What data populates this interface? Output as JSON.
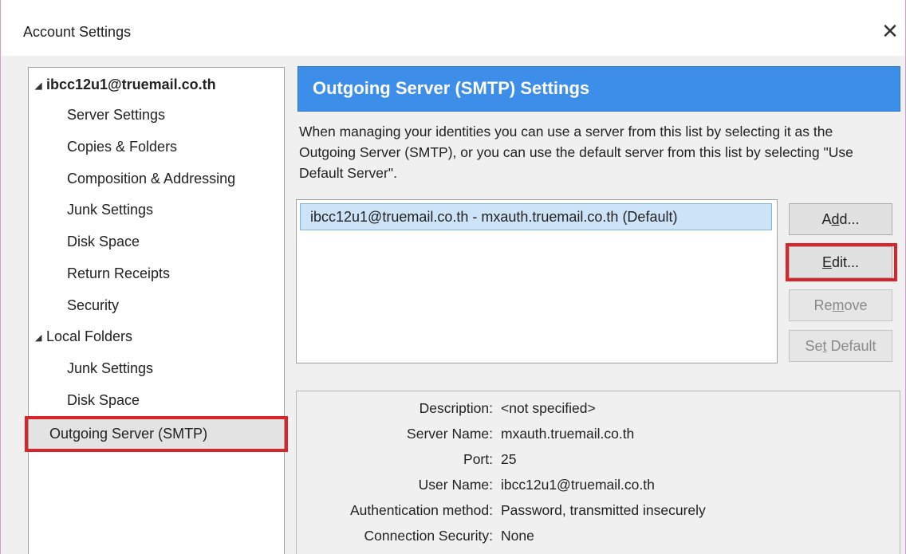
{
  "window": {
    "title": "Account Settings",
    "close_glyph": "✕"
  },
  "sidebar": {
    "account_root": "ibcc12u1@truemail.co.th",
    "account_items": [
      "Server Settings",
      "Copies & Folders",
      "Composition & Addressing",
      "Junk Settings",
      "Disk Space",
      "Return Receipts",
      "Security"
    ],
    "local_root": "Local Folders",
    "local_items": [
      "Junk Settings",
      "Disk Space"
    ],
    "selected_item": "Outgoing Server (SMTP)",
    "twisty_glyph": "◢"
  },
  "panel": {
    "header": "Outgoing Server (SMTP) Settings",
    "description": "When managing your identities you can use a server from this list by selecting it as the Outgoing Server (SMTP), or you can use the default server from this list by selecting \"Use Default Server\".",
    "servers": [
      "ibcc12u1@truemail.co.th - mxauth.truemail.co.th (Default)"
    ],
    "buttons": {
      "add": "Add...",
      "edit": "Edit...",
      "remove": "Remove",
      "set_default": "Set Default"
    }
  },
  "details": {
    "description_label": "Description:",
    "description_value": "<not specified>",
    "server_name_label": "Server Name:",
    "server_name_value": "mxauth.truemail.co.th",
    "port_label": "Port:",
    "port_value": "25",
    "user_name_label": "User Name:",
    "user_name_value": "ibcc12u1@truemail.co.th",
    "auth_label": "Authentication method:",
    "auth_value": "Password, transmitted insecurely",
    "security_label": "Connection Security:",
    "security_value": "None"
  },
  "colors": {
    "header_bg": "#3d8ee8",
    "highlight_red": "#d9252a",
    "selection_bg": "#cde3f7"
  }
}
